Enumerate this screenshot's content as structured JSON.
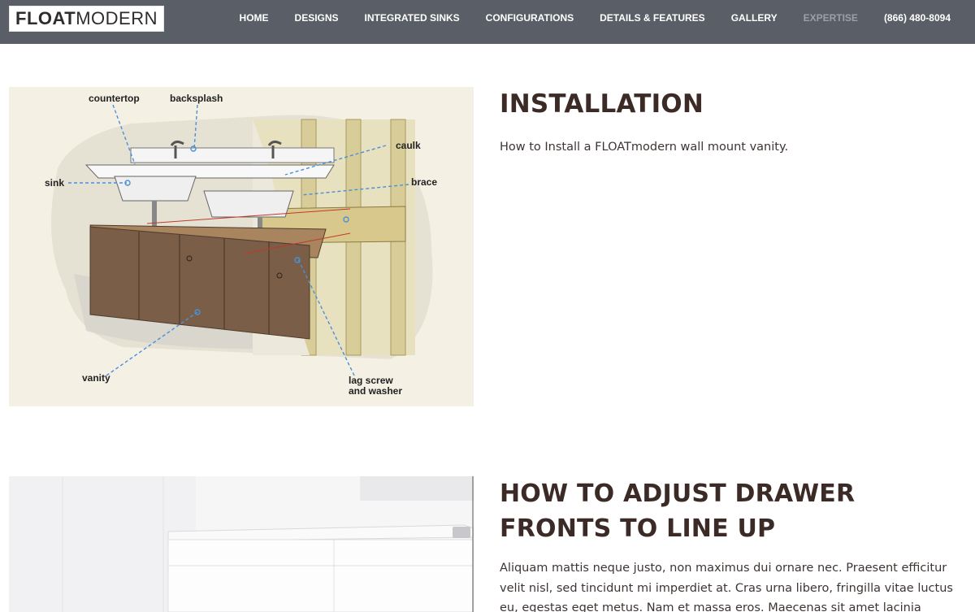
{
  "header": {
    "logo": {
      "bold": "FLOAT",
      "regular": "MODERN"
    },
    "nav": [
      {
        "label": "HOME",
        "active": false
      },
      {
        "label": "DESIGNS",
        "active": false
      },
      {
        "label": "INTEGRATED SINKS",
        "active": false
      },
      {
        "label": "CONFIGURATIONS",
        "active": false
      },
      {
        "label": "DETAILS & FEATURES",
        "active": false
      },
      {
        "label": "GALLERY",
        "active": false
      },
      {
        "label": "EXPERTISE",
        "active": true
      },
      {
        "label": "(866) 480-8094",
        "active": false
      }
    ]
  },
  "installation": {
    "heading": "INSTALLATION",
    "body": "How to Install a FLOATmodern wall mount vanity.",
    "diagram_labels": {
      "countertop": "countertop",
      "backsplash": "backsplash",
      "caulk": "caulk",
      "brace": "brace",
      "sink": "sink",
      "vanity": "vanity",
      "lag_screw_1": "lag screw",
      "lag_screw_2": "and washer"
    }
  },
  "drawer": {
    "heading": "HOW TO ADJUST DRAWER FRONTS TO LINE UP",
    "body": "Aliquam mattis neque justo, non maximus dui ornare nec. Praesent efficitur velit nisl, sed tincidunt mi imperdiet at. Cras urna libero, fringilla vitae luctus eu, egestas eget metus. Nam et massa eros. Maecenas sit amet lacinia lectus."
  },
  "colors": {
    "header_bg": "#5a5e67",
    "nav_text": "#ffffff",
    "nav_active": "#9aa0a8",
    "heading": "#3b2a25",
    "vanity_wood": "#7a5e48"
  }
}
